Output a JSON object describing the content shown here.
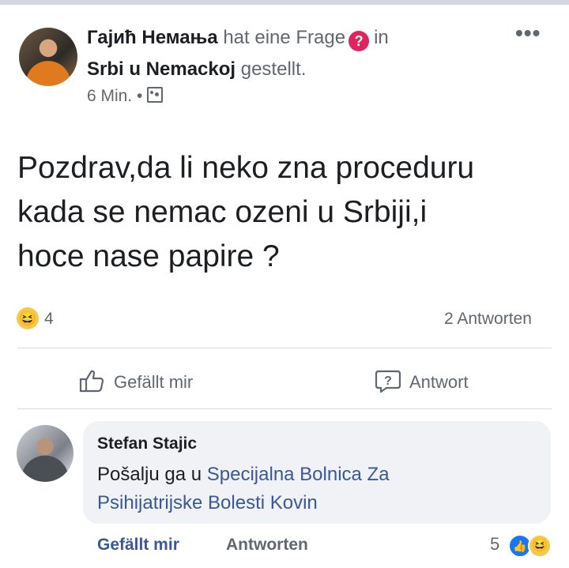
{
  "post": {
    "author": "Гајић Немања",
    "asked_text": "hat eine Frage",
    "in_text": "in",
    "group": "Srbi u Nemackoj",
    "posted_text": "gestellt.",
    "time": "6 Min. •",
    "more_label": "•••",
    "body_line1": "Pozdrav,da li neko zna proceduru",
    "body_line2": "kada se nemac ozeni u Srbiji,i",
    "body_line3": "hoce nase papire ?",
    "reaction_count": "4",
    "answers_count": "2 Antworten",
    "like_label": "Gefällt mir",
    "answer_label": "Antwort"
  },
  "comment": {
    "author": "Stefan Stajic",
    "text_prefix": "Pošalju ga u ",
    "link_line1": "Specijalna Bolnica Za",
    "link_line2": "Psihijatrijske Bolesti Kovin",
    "like_label": "Gefällt mir",
    "reply_label": "Antworten",
    "reaction_count": "5"
  },
  "icons": {
    "question": "?",
    "haha": "😆",
    "like": "👍"
  },
  "colors": {
    "link": "#385898",
    "question_badge": "#e0245e",
    "like_badge": "#1877f2"
  }
}
